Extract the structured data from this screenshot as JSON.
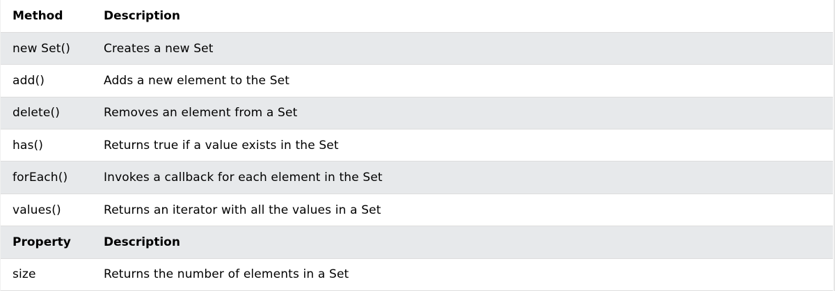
{
  "methods_table": {
    "header": {
      "col1": "Method",
      "col2": "Description"
    },
    "rows": [
      {
        "name": "new Set()",
        "description": "Creates a new Set"
      },
      {
        "name": "add()",
        "description": "Adds a new element to the Set"
      },
      {
        "name": "delete()",
        "description": "Removes an element from a Set"
      },
      {
        "name": "has()",
        "description": "Returns true if a value exists in the Set"
      },
      {
        "name": "forEach()",
        "description": "Invokes a callback for each element in the Set"
      },
      {
        "name": "values()",
        "description": "Returns an iterator with all the values in a Set"
      }
    ]
  },
  "properties_table": {
    "header": {
      "col1": "Property",
      "col2": "Description"
    },
    "rows": [
      {
        "name": "size",
        "description": "Returns the number of elements in a Set"
      }
    ]
  },
  "colors": {
    "header_bg": "#ffffff",
    "striped_bg": "#e7e9eb",
    "border": "#dddddd"
  }
}
